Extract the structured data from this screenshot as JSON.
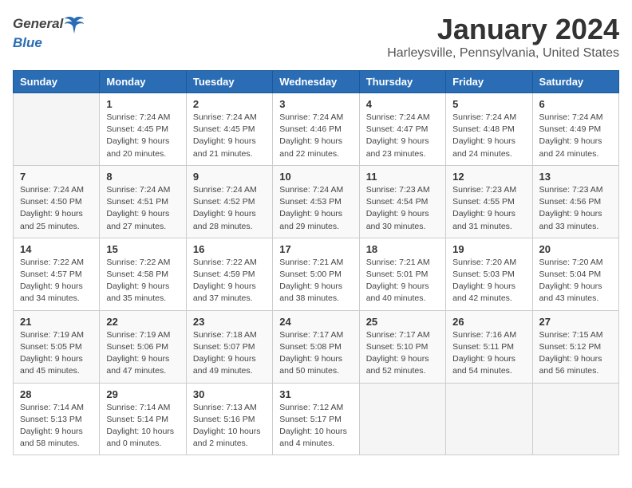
{
  "app": {
    "name_general": "General",
    "name_blue": "Blue"
  },
  "calendar": {
    "title": "January 2024",
    "subtitle": "Harleysville, Pennsylvania, United States",
    "days_of_week": [
      "Sunday",
      "Monday",
      "Tuesday",
      "Wednesday",
      "Thursday",
      "Friday",
      "Saturday"
    ],
    "weeks": [
      [
        {
          "day": "",
          "info": ""
        },
        {
          "day": "1",
          "info": "Sunrise: 7:24 AM\nSunset: 4:45 PM\nDaylight: 9 hours\nand 20 minutes."
        },
        {
          "day": "2",
          "info": "Sunrise: 7:24 AM\nSunset: 4:45 PM\nDaylight: 9 hours\nand 21 minutes."
        },
        {
          "day": "3",
          "info": "Sunrise: 7:24 AM\nSunset: 4:46 PM\nDaylight: 9 hours\nand 22 minutes."
        },
        {
          "day": "4",
          "info": "Sunrise: 7:24 AM\nSunset: 4:47 PM\nDaylight: 9 hours\nand 23 minutes."
        },
        {
          "day": "5",
          "info": "Sunrise: 7:24 AM\nSunset: 4:48 PM\nDaylight: 9 hours\nand 24 minutes."
        },
        {
          "day": "6",
          "info": "Sunrise: 7:24 AM\nSunset: 4:49 PM\nDaylight: 9 hours\nand 24 minutes."
        }
      ],
      [
        {
          "day": "7",
          "info": "Sunrise: 7:24 AM\nSunset: 4:50 PM\nDaylight: 9 hours\nand 25 minutes."
        },
        {
          "day": "8",
          "info": "Sunrise: 7:24 AM\nSunset: 4:51 PM\nDaylight: 9 hours\nand 27 minutes."
        },
        {
          "day": "9",
          "info": "Sunrise: 7:24 AM\nSunset: 4:52 PM\nDaylight: 9 hours\nand 28 minutes."
        },
        {
          "day": "10",
          "info": "Sunrise: 7:24 AM\nSunset: 4:53 PM\nDaylight: 9 hours\nand 29 minutes."
        },
        {
          "day": "11",
          "info": "Sunrise: 7:23 AM\nSunset: 4:54 PM\nDaylight: 9 hours\nand 30 minutes."
        },
        {
          "day": "12",
          "info": "Sunrise: 7:23 AM\nSunset: 4:55 PM\nDaylight: 9 hours\nand 31 minutes."
        },
        {
          "day": "13",
          "info": "Sunrise: 7:23 AM\nSunset: 4:56 PM\nDaylight: 9 hours\nand 33 minutes."
        }
      ],
      [
        {
          "day": "14",
          "info": "Sunrise: 7:22 AM\nSunset: 4:57 PM\nDaylight: 9 hours\nand 34 minutes."
        },
        {
          "day": "15",
          "info": "Sunrise: 7:22 AM\nSunset: 4:58 PM\nDaylight: 9 hours\nand 35 minutes."
        },
        {
          "day": "16",
          "info": "Sunrise: 7:22 AM\nSunset: 4:59 PM\nDaylight: 9 hours\nand 37 minutes."
        },
        {
          "day": "17",
          "info": "Sunrise: 7:21 AM\nSunset: 5:00 PM\nDaylight: 9 hours\nand 38 minutes."
        },
        {
          "day": "18",
          "info": "Sunrise: 7:21 AM\nSunset: 5:01 PM\nDaylight: 9 hours\nand 40 minutes."
        },
        {
          "day": "19",
          "info": "Sunrise: 7:20 AM\nSunset: 5:03 PM\nDaylight: 9 hours\nand 42 minutes."
        },
        {
          "day": "20",
          "info": "Sunrise: 7:20 AM\nSunset: 5:04 PM\nDaylight: 9 hours\nand 43 minutes."
        }
      ],
      [
        {
          "day": "21",
          "info": "Sunrise: 7:19 AM\nSunset: 5:05 PM\nDaylight: 9 hours\nand 45 minutes."
        },
        {
          "day": "22",
          "info": "Sunrise: 7:19 AM\nSunset: 5:06 PM\nDaylight: 9 hours\nand 47 minutes."
        },
        {
          "day": "23",
          "info": "Sunrise: 7:18 AM\nSunset: 5:07 PM\nDaylight: 9 hours\nand 49 minutes."
        },
        {
          "day": "24",
          "info": "Sunrise: 7:17 AM\nSunset: 5:08 PM\nDaylight: 9 hours\nand 50 minutes."
        },
        {
          "day": "25",
          "info": "Sunrise: 7:17 AM\nSunset: 5:10 PM\nDaylight: 9 hours\nand 52 minutes."
        },
        {
          "day": "26",
          "info": "Sunrise: 7:16 AM\nSunset: 5:11 PM\nDaylight: 9 hours\nand 54 minutes."
        },
        {
          "day": "27",
          "info": "Sunrise: 7:15 AM\nSunset: 5:12 PM\nDaylight: 9 hours\nand 56 minutes."
        }
      ],
      [
        {
          "day": "28",
          "info": "Sunrise: 7:14 AM\nSunset: 5:13 PM\nDaylight: 9 hours\nand 58 minutes."
        },
        {
          "day": "29",
          "info": "Sunrise: 7:14 AM\nSunset: 5:14 PM\nDaylight: 10 hours\nand 0 minutes."
        },
        {
          "day": "30",
          "info": "Sunrise: 7:13 AM\nSunset: 5:16 PM\nDaylight: 10 hours\nand 2 minutes."
        },
        {
          "day": "31",
          "info": "Sunrise: 7:12 AM\nSunset: 5:17 PM\nDaylight: 10 hours\nand 4 minutes."
        },
        {
          "day": "",
          "info": ""
        },
        {
          "day": "",
          "info": ""
        },
        {
          "day": "",
          "info": ""
        }
      ]
    ]
  }
}
